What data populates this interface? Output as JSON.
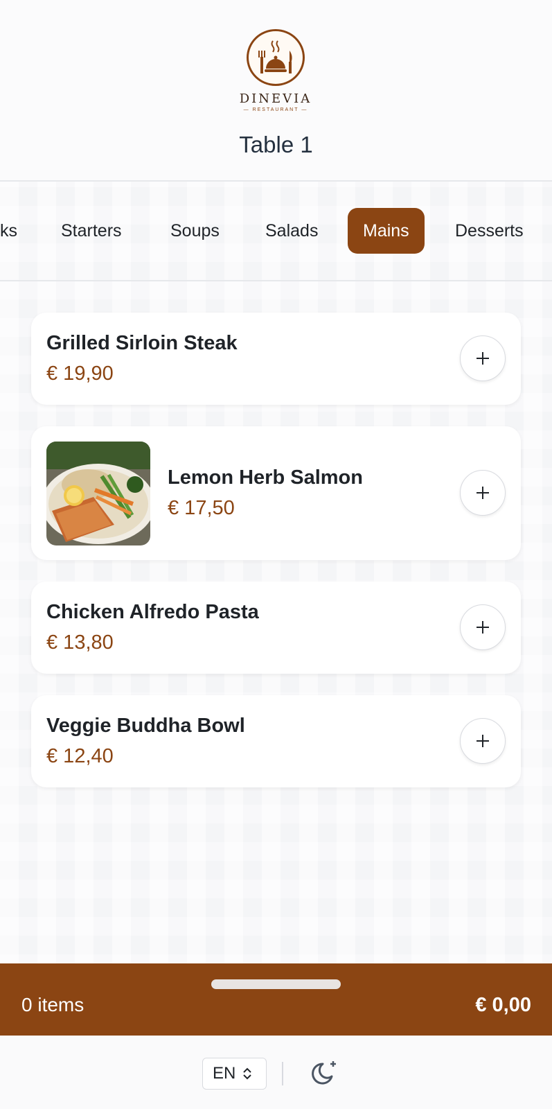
{
  "header": {
    "logo": {
      "name": "DINEVIA",
      "sub": "— RESTAURANT —"
    },
    "table_title": "Table 1"
  },
  "categories": {
    "items": [
      "ks",
      "Starters",
      "Soups",
      "Salads",
      "Mains",
      "Desserts"
    ],
    "active": "Mains"
  },
  "menu": {
    "items": [
      {
        "name": "Grilled Sirloin Steak",
        "price": "€ 19,90",
        "has_image": false
      },
      {
        "name": "Lemon Herb Salmon",
        "price": "€ 17,50",
        "has_image": true,
        "image_icon": "salmon-dish-photo"
      },
      {
        "name": "Chicken Alfredo Pasta",
        "price": "€ 13,80",
        "has_image": false
      },
      {
        "name": "Veggie Buddha Bowl",
        "price": "€ 12,40",
        "has_image": false
      }
    ],
    "add_icon": "plus-icon"
  },
  "cart": {
    "items_label": "0 items",
    "total": "€ 0,00"
  },
  "footer": {
    "language": "EN",
    "language_icon": "chevron-up-down-icon",
    "theme_icon": "moon-sparkle-icon"
  },
  "colors": {
    "brand": "#8b4513",
    "text": "#1f2328",
    "background": "#f4f5f7"
  }
}
